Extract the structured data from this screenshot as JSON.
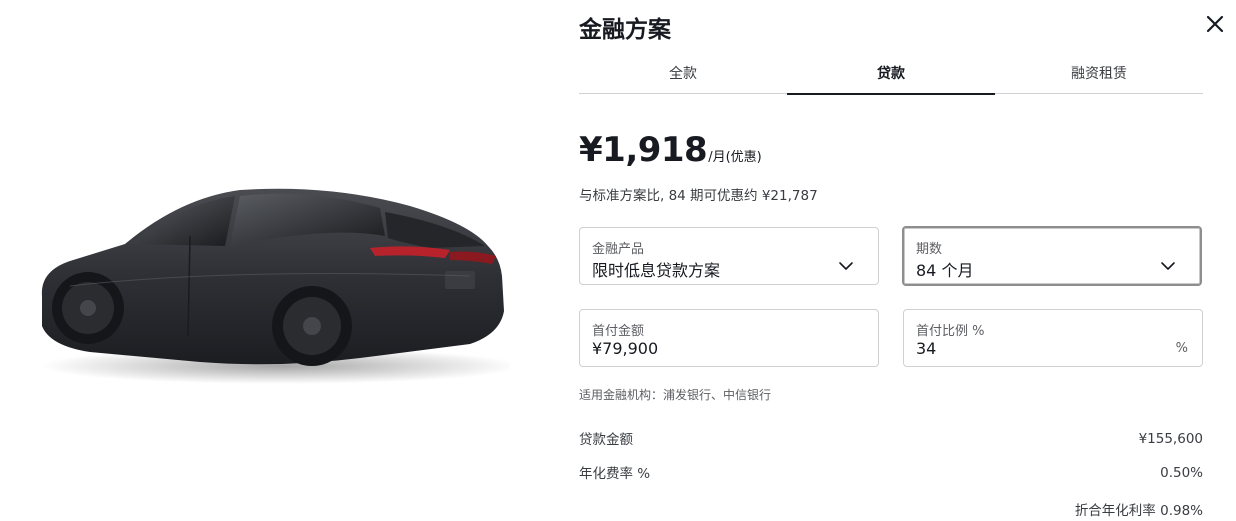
{
  "title": "金融方案",
  "tabs": [
    {
      "label": "全款",
      "active": false
    },
    {
      "label": "贷款",
      "active": true
    },
    {
      "label": "融资租赁",
      "active": false
    }
  ],
  "price": {
    "amount": "¥1,918",
    "suffix": "/月(优惠)",
    "saving_text": "与标准方案比, 84 期可优惠约 ¥21,787"
  },
  "fields": {
    "product": {
      "label": "金融产品",
      "value": "限时低息贷款方案"
    },
    "term": {
      "label": "期数",
      "value": "84 个月"
    },
    "down_amount": {
      "label": "首付金额",
      "value": "¥79,900"
    },
    "down_ratio": {
      "label": "首付比例 %",
      "value": "34",
      "unit": "%"
    }
  },
  "institutions": "适用金融机构：浦发银行、中信银行",
  "summary": {
    "loan_amount": {
      "label": "贷款金额",
      "value": "¥155,600"
    },
    "annual_rate": {
      "label": "年化费率 %",
      "value": "0.50%"
    },
    "equivalent_rate": "折合年化利率 0.98%"
  },
  "icons": {
    "close": "close-icon",
    "chevron": "chevron-down-icon"
  },
  "colors": {
    "text": "#171a20",
    "muted": "#5c5e62",
    "border": "#d0d1d2",
    "car_body": "#2b2d31"
  }
}
